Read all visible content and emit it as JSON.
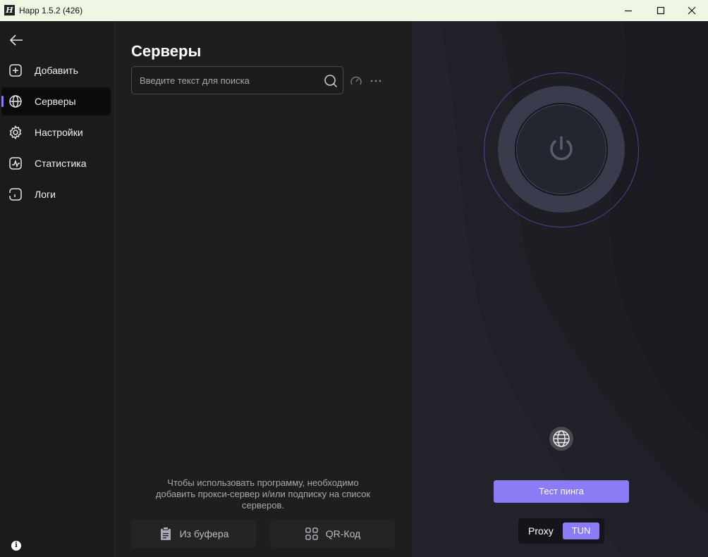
{
  "window": {
    "title": "Happ 1.5.2 (426)",
    "icon": "happ-logo",
    "icon_letter": "H"
  },
  "sidebar": {
    "back_icon": "arrow-left-icon",
    "items": [
      {
        "label": "Добавить",
        "icon": "plus-square-icon",
        "active": false
      },
      {
        "label": "Серверы",
        "icon": "globe-icon",
        "active": true
      },
      {
        "label": "Настройки",
        "icon": "gear-icon",
        "active": false
      },
      {
        "label": "Статистика",
        "icon": "chart-icon",
        "active": false
      },
      {
        "label": "Логи",
        "icon": "log-icon",
        "active": false
      }
    ],
    "info_glyph": "i"
  },
  "main": {
    "title": "Серверы",
    "search": {
      "placeholder": "Введите текст для поиска",
      "value": ""
    },
    "hint": "Чтобы использовать программу, необходимо добавить прокси-сервер и/или подписку на список серверов.",
    "buttons": {
      "clipboard_label": "Из буфера",
      "qr_label": "QR-Код"
    }
  },
  "connection": {
    "power_icon": "power-icon",
    "location_icon": "globe-icon",
    "ping_label": "Тест пинга",
    "mode": {
      "proxy_label": "Proxy",
      "tun_label": "TUN",
      "selected": "TUN"
    }
  },
  "colors": {
    "accent": "#8b7cf6",
    "sidebar_bg": "#1b1b1b",
    "main_bg": "#1e1e1e",
    "panel_bg": "#1a1b20",
    "titlebar_bg": "#eef6e4"
  }
}
